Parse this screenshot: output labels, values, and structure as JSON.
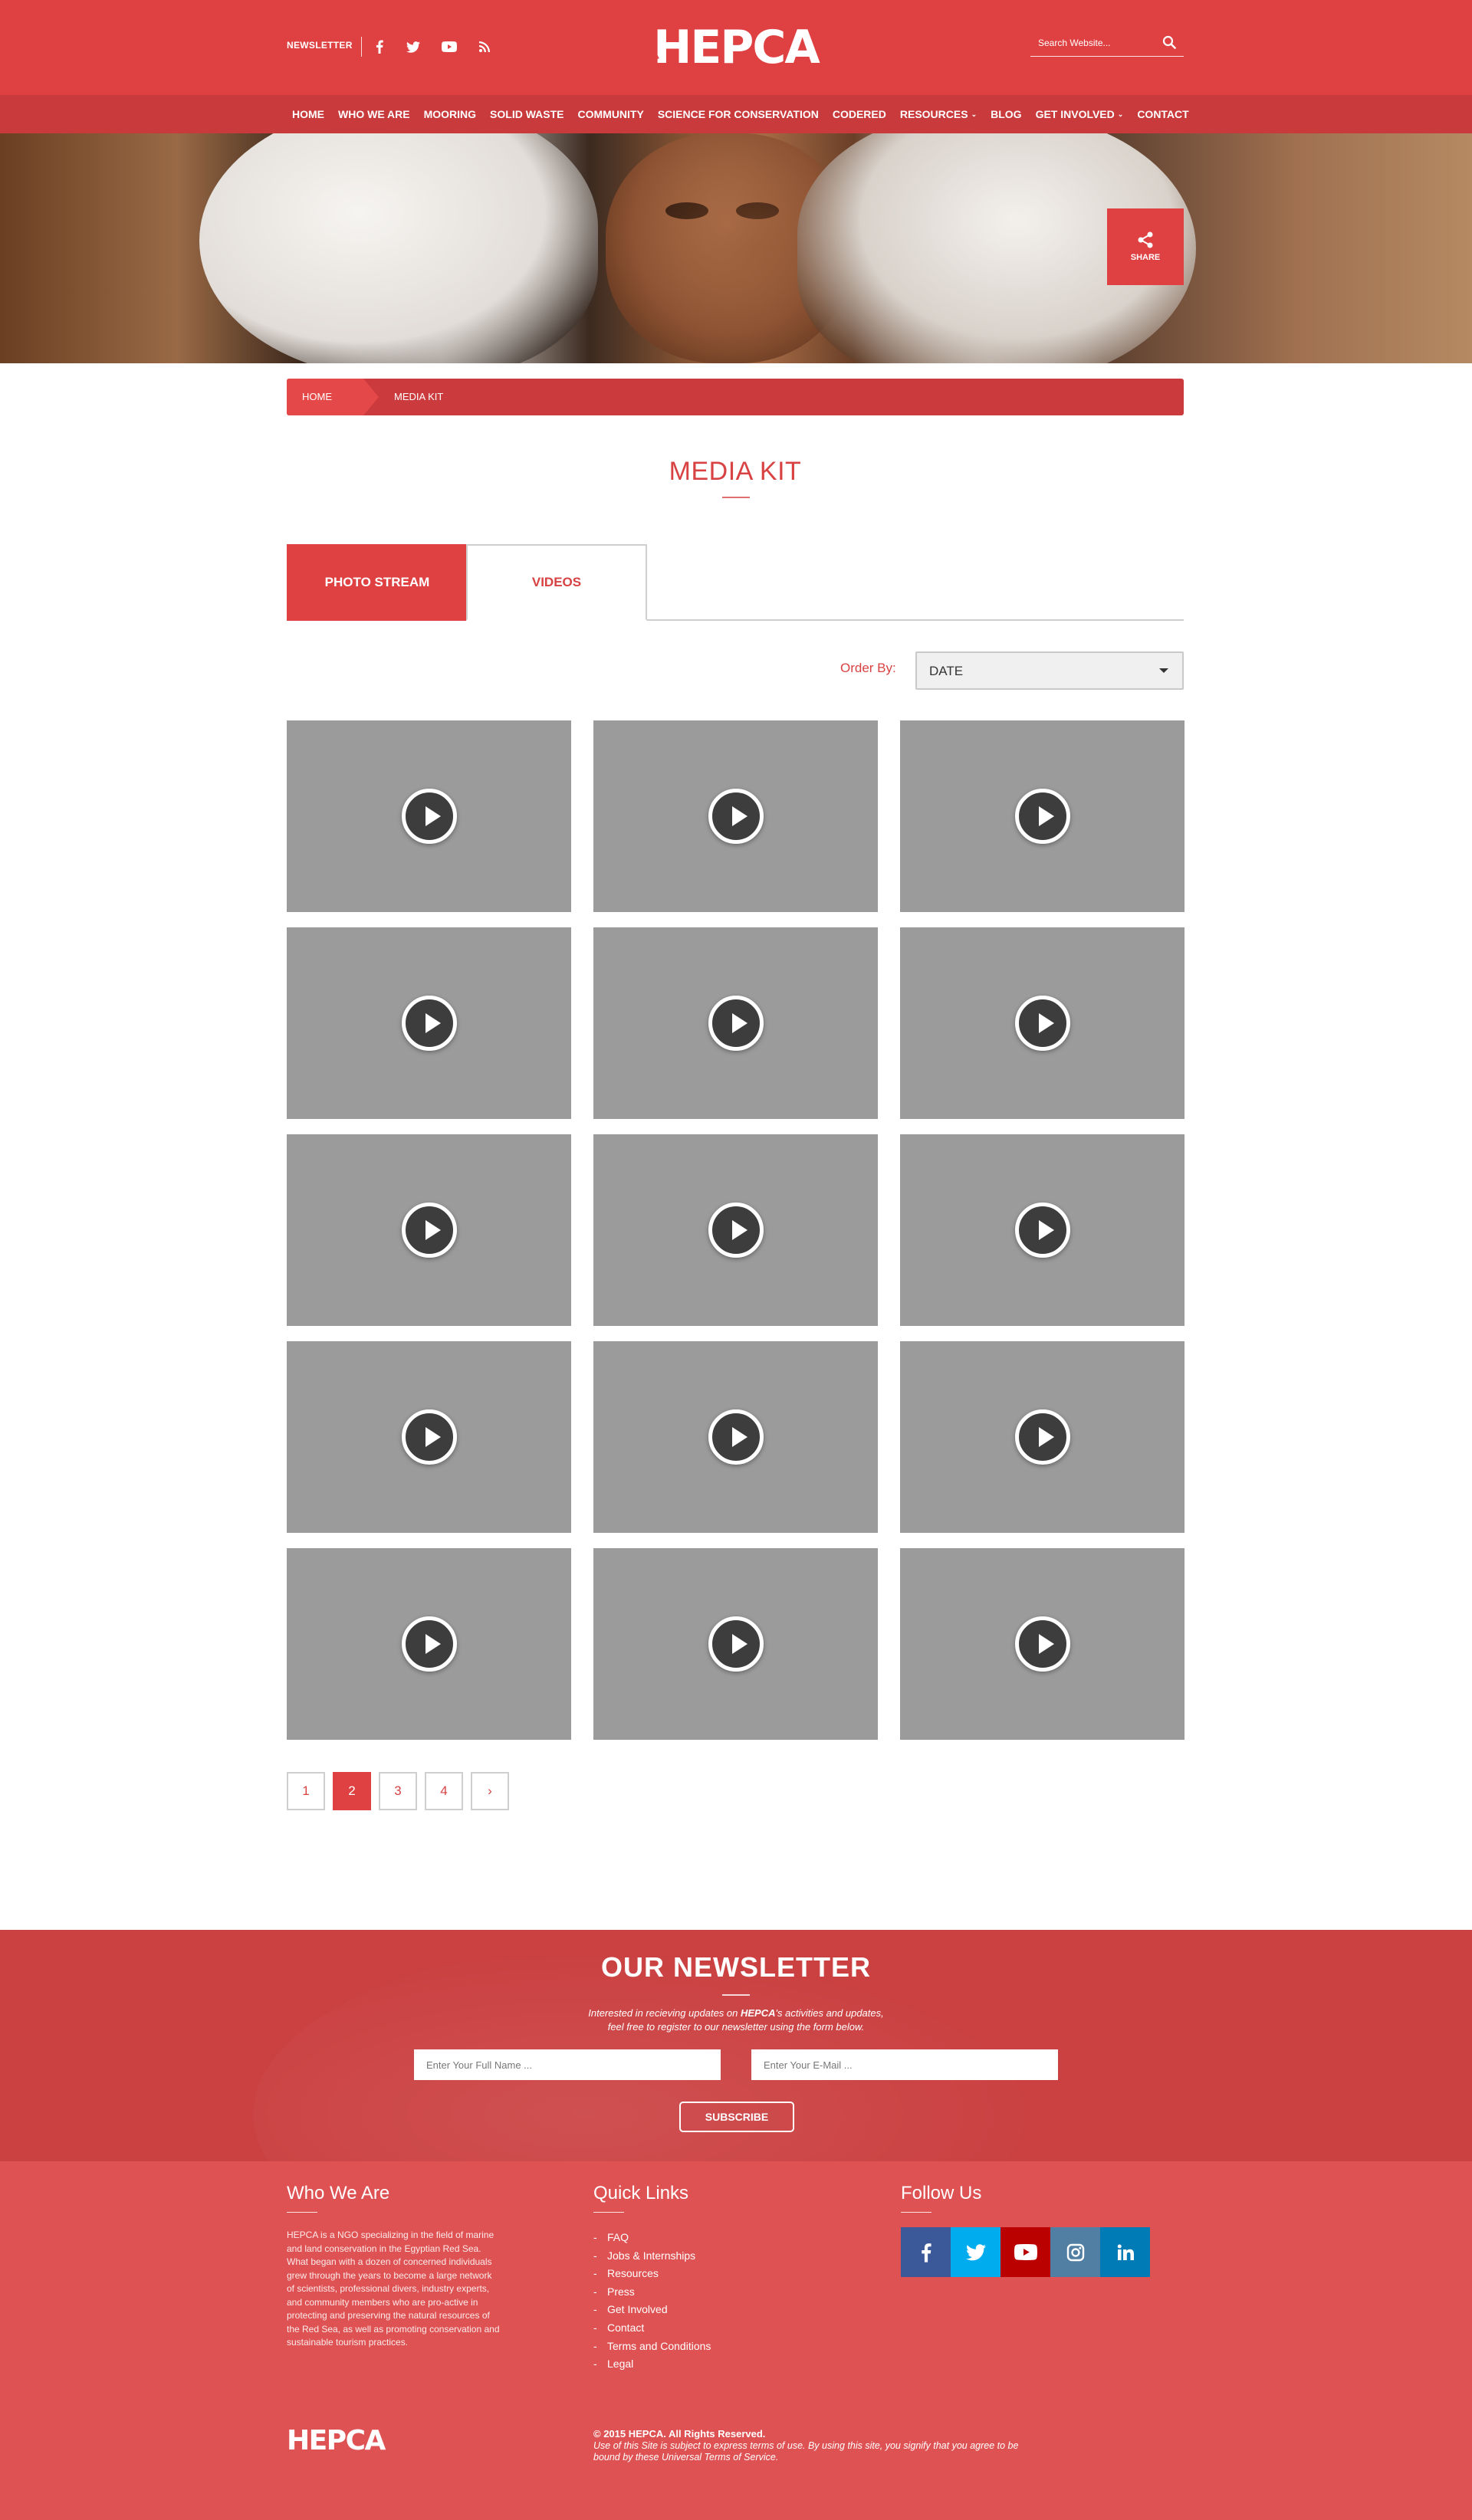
{
  "header": {
    "newsletter_label": "NEWSLETTER",
    "logo_text": "HEPCA",
    "search_placeholder": "Search Website...",
    "social_icons": [
      "facebook-icon",
      "twitter-icon",
      "youtube-icon",
      "rss-icon"
    ]
  },
  "nav": {
    "items": [
      {
        "label": "HOME"
      },
      {
        "label": "WHO WE ARE"
      },
      {
        "label": "MOORING"
      },
      {
        "label": "SOLID WASTE"
      },
      {
        "label": "COMMUNITY"
      },
      {
        "label": "SCIENCE FOR CONSERVATION"
      },
      {
        "label": "CODERED"
      },
      {
        "label": "RESOURCES",
        "dropdown": true
      },
      {
        "label": "BLOG"
      },
      {
        "label": "GET INVOLVED",
        "dropdown": true
      },
      {
        "label": "CONTACT"
      }
    ]
  },
  "hero": {
    "share_label": "SHARE"
  },
  "breadcrumb": {
    "home": "HOME",
    "current": "MEDIA KIT"
  },
  "page": {
    "title": "MEDIA KIT"
  },
  "tabs": [
    {
      "label": "PHOTO STREAM",
      "active": true
    },
    {
      "label": "VIDEOS",
      "active": false
    }
  ],
  "order": {
    "label": "Order By:",
    "selected": "DATE"
  },
  "videos": {
    "count": 15,
    "columns": 3,
    "thumbnail_color": "#9b9b9b",
    "icon": "play-icon"
  },
  "pagination": {
    "pages": [
      "1",
      "2",
      "3",
      "4"
    ],
    "current": "2",
    "next_icon": "chevron-right-icon",
    "next_label": "›"
  },
  "newsletter": {
    "title": "OUR NEWSLETTER",
    "text_before": "Interested in recieving updates on ",
    "brand": "HEPCA",
    "text_after_line1": "'s activities and updates,",
    "text_line2": "feel free to register to our newsletter using the form below.",
    "name_placeholder": "Enter Your Full Name ...",
    "email_placeholder": "Enter Your E-Mail ...",
    "subscribe_label": "SUBSCRIBE"
  },
  "footer": {
    "who_title": "Who We Are",
    "who_text": "HEPCA is a NGO specializing in the field of marine and land conservation in the Egyptian Red Sea. What began with a dozen of concerned individuals grew through the years to become a large network of scientists, professional divers, industry experts, and community members who are pro-active in protecting and preserving the natural resources of the Red Sea, as well as promoting conservation and sustainable tourism practices.",
    "links_title": "Quick Links",
    "links": [
      "FAQ",
      "Jobs & Internships",
      "Resources",
      "Press",
      "Get Involved",
      "Contact",
      "Terms and Conditions",
      "Legal"
    ],
    "follow_title": "Follow Us",
    "social": [
      {
        "icon": "facebook-icon",
        "color": "#3b5998"
      },
      {
        "icon": "twitter-icon",
        "color": "#00aced"
      },
      {
        "icon": "youtube-icon",
        "color": "#bb0000"
      },
      {
        "icon": "instagram-icon",
        "color": "#517fa4"
      },
      {
        "icon": "linkedin-icon",
        "color": "#007bb6"
      }
    ],
    "copyright": "© 2015 HEPCA. All Rights Reserved.",
    "terms_text": "Use of this Site is subject to express terms of use. By using this site, you signify that you agree to be bound by these Universal Terms of Service."
  },
  "colors": {
    "brand_red": "#df4142",
    "nav_red": "#c93a3c",
    "footer_red": "#df5253",
    "newsletter_red": "#cb4142"
  }
}
